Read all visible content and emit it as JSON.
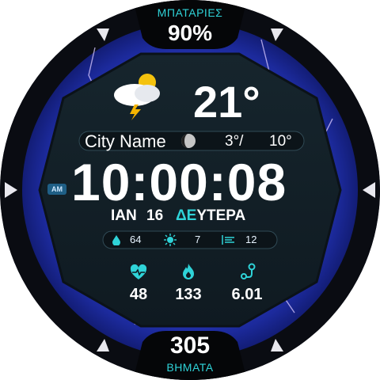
{
  "battery": {
    "label": "ΜΠΑΤΑΡΙΕΣ",
    "value": "90%"
  },
  "weather": {
    "icon": "partly-cloudy-storm-icon",
    "temperature": "21°",
    "city": "City Name",
    "moon_icon": "moon-phase-icon",
    "low": "3°/",
    "high": "10°"
  },
  "time": {
    "ampm": "AM",
    "value": "10:00:08"
  },
  "date": {
    "month": "ΙΑΝ",
    "day": "16",
    "weekday": "ΔΕΥΤΕΡΑ"
  },
  "conditions": {
    "humidity": {
      "icon": "humidity-drop-icon",
      "value": "64"
    },
    "uv": {
      "icon": "sun-uv-icon",
      "value": "7"
    },
    "wind": {
      "icon": "wind-icon",
      "value": "12"
    }
  },
  "health": {
    "heart_rate": {
      "icon": "heart-rate-icon",
      "value": "48"
    },
    "calories": {
      "icon": "calories-flame-icon",
      "value": "133"
    },
    "distance": {
      "icon": "distance-route-icon",
      "value": "6.01"
    }
  },
  "steps": {
    "value": "305",
    "label": "ΒΗΜΑΤΑ"
  },
  "colors": {
    "accent": "#2fd3d8",
    "panel": "#15232b",
    "lightning_bg": "#2a3ec8"
  }
}
